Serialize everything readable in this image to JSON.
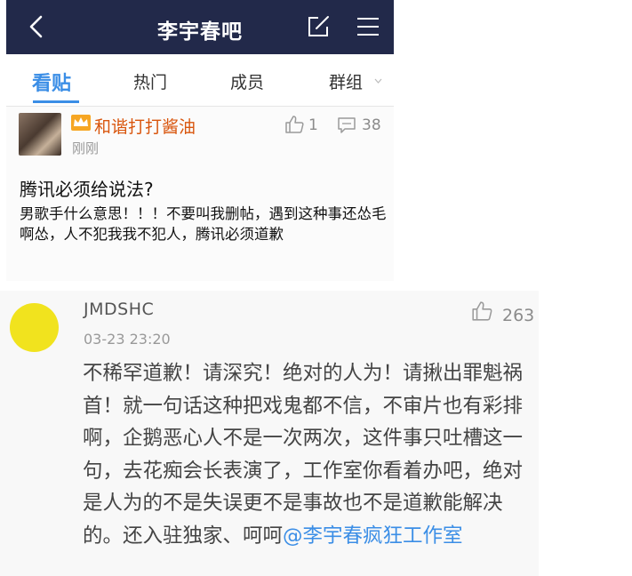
{
  "header": {
    "title": "李宇春吧"
  },
  "tabs": [
    {
      "label": "看贴",
      "active": true
    },
    {
      "label": "热门"
    },
    {
      "label": "成员"
    },
    {
      "label": "群组"
    }
  ],
  "post": {
    "username": "和谐打打酱油",
    "time": "刚刚",
    "likes": "1",
    "comments": "38",
    "title": "腾讯必须给说法?",
    "body": "男歌手什么意思！！！不要叫我删帖，遇到这种事还怂毛啊怂，人不犯我我不犯人，腾讯必须道歉"
  },
  "comment": {
    "username": "JMDSHC",
    "time": "03-23 23:20",
    "likes": "263",
    "body_text": "不稀罕道歉！请深究！绝对的人为！请揪出罪魁祸首！就一句话这种把戏鬼都不信，不审片也有彩排啊，企鹅恶心人不是一次两次，这件事只吐槽这一句，去花痴会长表演了，工作室你看着办吧，绝对是人为的不是失误更不是事故也不是道歉能解决的。还入驻独家、呵呵",
    "mention": "@李宇春疯狂工作室"
  },
  "colors": {
    "header_bg": "#22294a",
    "accent": "#3b8ee6",
    "username": "#d9560e",
    "avatar_dot": "#f1e31e"
  },
  "icons": [
    "back-chevron-icon",
    "edit-icon",
    "menu-icon",
    "chevron-down-icon",
    "crown-badge-icon",
    "thumbs-up-icon",
    "comment-icon"
  ]
}
